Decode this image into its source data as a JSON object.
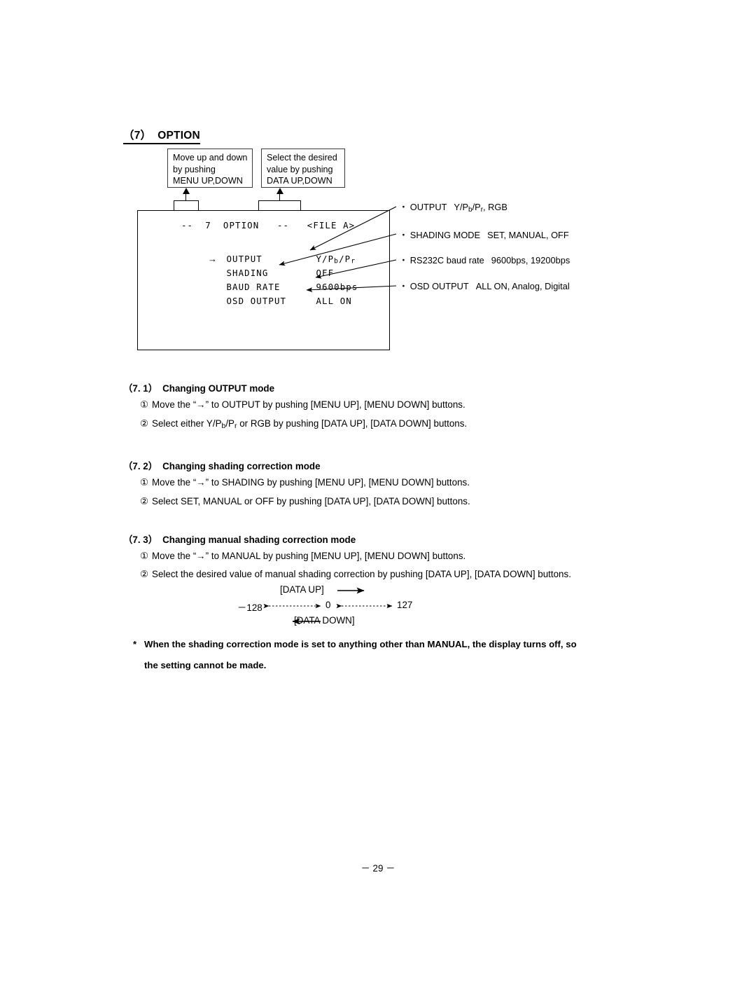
{
  "heading": {
    "number": "（7）",
    "title": "OPTION"
  },
  "callouts": [
    {
      "name": "menu-updown",
      "line1": "Move up and down",
      "line2": "by pushing",
      "line3": "MENU UP,DOWN"
    },
    {
      "name": "data-updown",
      "line1": "Select the desired",
      "line2": "value by pushing",
      "line3": "DATA UP,DOWN"
    }
  ],
  "osd": {
    "title": "--  7  OPTION   --   <FILE A>",
    "cursor": "→",
    "rows": [
      {
        "label": "OUTPUT",
        "value": "Y/Pb/Pr",
        "selected": true
      },
      {
        "label": "SHADING",
        "value": "OFF",
        "selected": false
      },
      {
        "label": "BAUD RATE",
        "value": "9600bps",
        "selected": false
      },
      {
        "label": "OSD OUTPUT",
        "value": "ALL ON",
        "selected": false
      }
    ]
  },
  "annotations": [
    {
      "bullet": "・",
      "name": "OUTPUT",
      "options": "Y/Pb/Pr, RGB"
    },
    {
      "bullet": "・",
      "name": "SHADING MODE",
      "options": "SET, MANUAL, OFF"
    },
    {
      "bullet": "・",
      "name": "RS232C baud rate",
      "options": "9600bps, 19200bps"
    },
    {
      "bullet": "・",
      "name": "OSD OUTPUT",
      "options": "ALL ON, Analog, Digital"
    }
  ],
  "sections": [
    {
      "number": "（7. 1）",
      "title": "Changing OUTPUT mode",
      "steps": [
        {
          "marker": "①",
          "text": "Move the “→” to OUTPUT by pushing [MENU UP], [MENU DOWN] buttons."
        },
        {
          "marker": "②",
          "text": "Select either Y/Pb/Pr or RGB by pushing [DATA UP], [DATA DOWN] buttons."
        }
      ]
    },
    {
      "number": "（7. 2）",
      "title": "Changing shading correction mode",
      "steps": [
        {
          "marker": "①",
          "text": "Move the “→” to SHADING by pushing [MENU UP], [MENU DOWN] buttons."
        },
        {
          "marker": "②",
          "text": "Select SET, MANUAL or OFF by pushing [DATA UP], [DATA DOWN] buttons."
        }
      ]
    },
    {
      "number": "（7. 3）",
      "title": "Changing manual shading correction mode",
      "steps": [
        {
          "marker": "①",
          "text": "Move the “→” to MANUAL by pushing [MENU UP], [MENU DOWN] buttons."
        },
        {
          "marker": "②",
          "text": "Select the desired value of manual shading correction by pushing [DATA UP], [DATA DOWN] buttons."
        }
      ]
    }
  ],
  "range_diagram": {
    "up_label": "[DATA UP]",
    "down_label": "[DATA DOWN]",
    "min": "－128",
    "center": "0",
    "max": "127"
  },
  "footnote": {
    "star": "*",
    "line1": "When the shading correction mode is set to anything other than MANUAL, the display turns off, so",
    "line2": "the setting cannot be made."
  },
  "page_number": "－ 29 －"
}
